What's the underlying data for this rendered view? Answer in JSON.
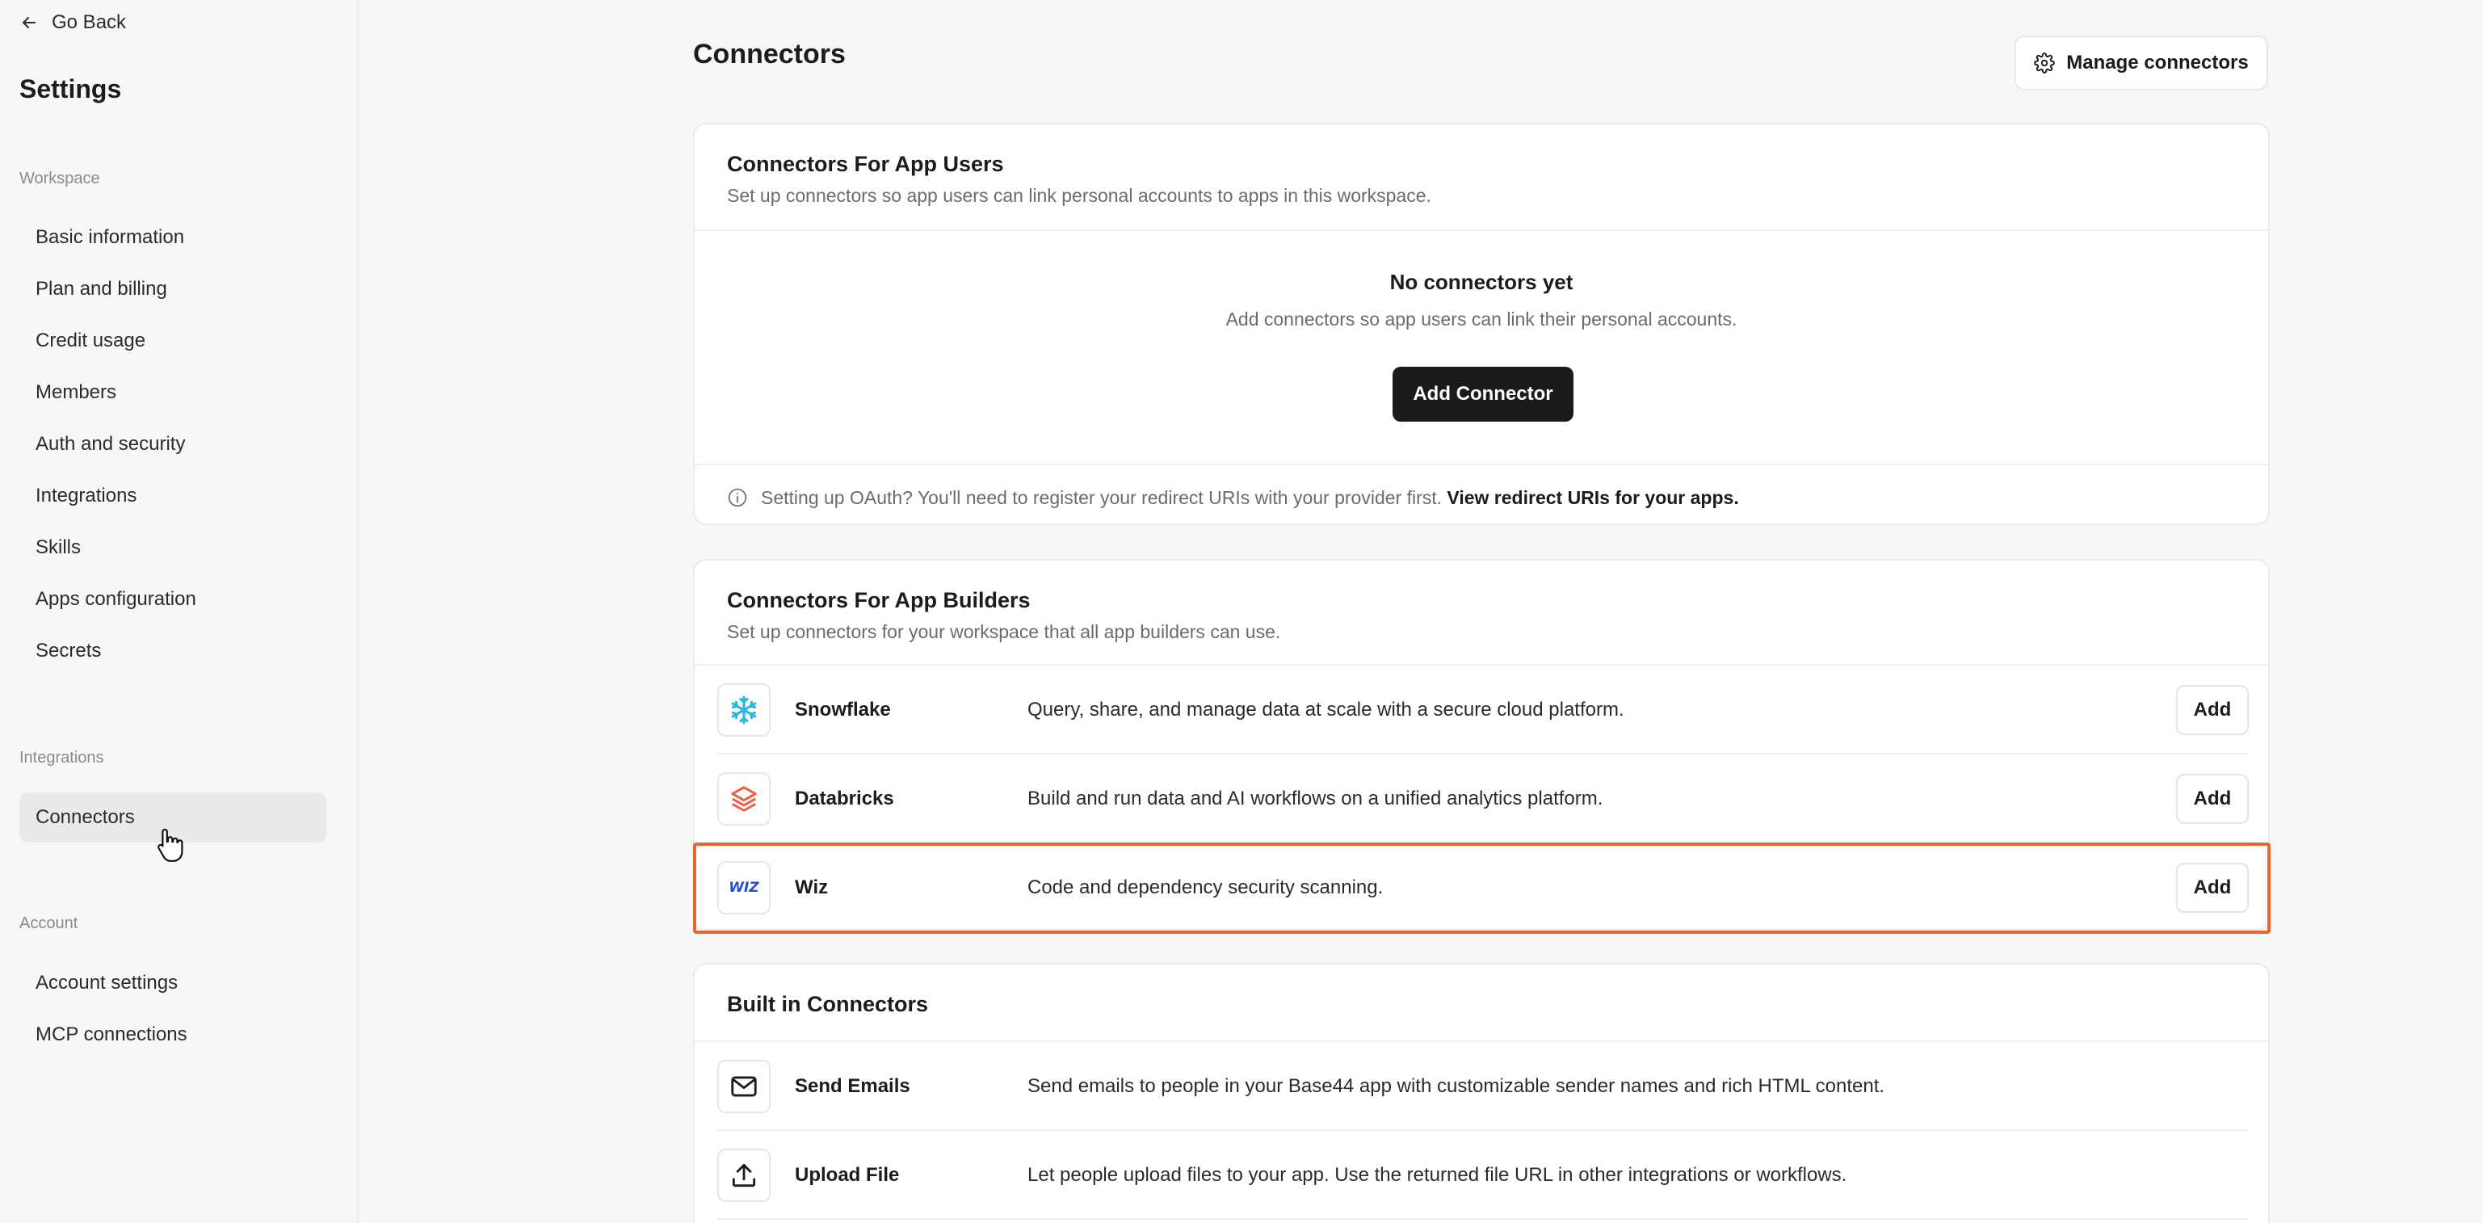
{
  "sidebar": {
    "go_back": "Go Back",
    "title": "Settings",
    "groups": [
      {
        "label": "Workspace",
        "items": [
          "Basic information",
          "Plan and billing",
          "Credit usage",
          "Members",
          "Auth and security",
          "Integrations",
          "Skills",
          "Apps configuration",
          "Secrets"
        ]
      },
      {
        "label": "Integrations",
        "items": [
          "Connectors"
        ]
      },
      {
        "label": "Account",
        "items": [
          "Account settings",
          "MCP connections"
        ]
      }
    ],
    "active_item": "Connectors"
  },
  "main": {
    "title": "Connectors",
    "manage_button": "Manage connectors",
    "app_users": {
      "title": "Connectors For App Users",
      "subtitle": "Set up connectors so app users can link personal accounts to apps in this workspace.",
      "empty_title": "No connectors yet",
      "empty_subtitle": "Add connectors so app users can link their personal accounts.",
      "add_button": "Add Connector",
      "oauth_note": "Setting up OAuth? You'll need to register your redirect URIs with your provider first.",
      "oauth_link": "View redirect URIs for your apps."
    },
    "app_builders": {
      "title": "Connectors For App Builders",
      "subtitle": "Set up connectors for your workspace that all app builders can use.",
      "items": [
        {
          "name": "Snowflake",
          "desc": "Query, share, and manage data at scale with a secure cloud platform.",
          "action": "Add",
          "icon": "snowflake-icon"
        },
        {
          "name": "Databricks",
          "desc": "Build and run data and AI workflows on a unified analytics platform.",
          "action": "Add",
          "icon": "databricks-icon"
        },
        {
          "name": "Wiz",
          "desc": "Code and dependency security scanning.",
          "action": "Add",
          "icon": "wiz-icon",
          "icon_text": "WIZ"
        }
      ]
    },
    "built_in": {
      "title": "Built in Connectors",
      "items": [
        {
          "name": "Send Emails",
          "desc": "Send emails to people in your Base44 app with customizable sender names and rich HTML content.",
          "icon": "mail-icon"
        },
        {
          "name": "Upload File",
          "desc": "Let people upload files to your app. Use the returned file URL in other integrations or workflows.",
          "icon": "upload-icon"
        }
      ]
    }
  },
  "colors": {
    "highlight": "#e8672c",
    "primary_button": "#1b1b1b",
    "snowflake": "#29b5e8",
    "databricks": "#ee5a3c",
    "wiz": "#2a4bd7"
  }
}
